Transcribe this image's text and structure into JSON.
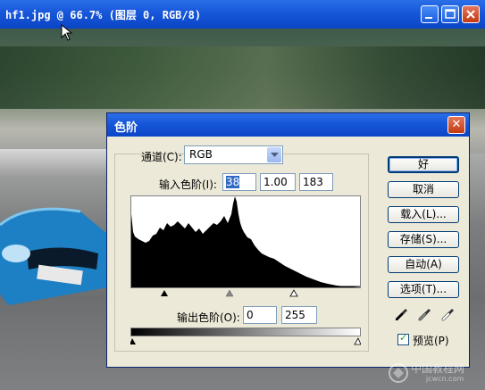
{
  "document": {
    "title": "hf1.jpg @ 66.7% (图层 0, RGB/8)"
  },
  "dialog": {
    "title": "色阶",
    "close_glyph": "✕",
    "channel_label": "通道(C):",
    "channel_value": "RGB",
    "input_levels_label": "输入色阶(I):",
    "input_black": "38",
    "input_gamma": "1.00",
    "input_white": "183",
    "output_levels_label": "输出色阶(O):",
    "output_black": "0",
    "output_white": "255",
    "buttons": {
      "ok": "好",
      "cancel": "取消",
      "load": "载入(L)...",
      "save": "存储(S)...",
      "auto": "自动(A)",
      "options": "选项(T)..."
    },
    "preview_label": "预览(P)",
    "preview_checked": true,
    "icons": [
      "black-eyedropper-icon",
      "gray-eyedropper-icon",
      "white-eyedropper-icon"
    ]
  },
  "watermark": {
    "text": "中国教程网",
    "url": "jcwcn.com"
  }
}
